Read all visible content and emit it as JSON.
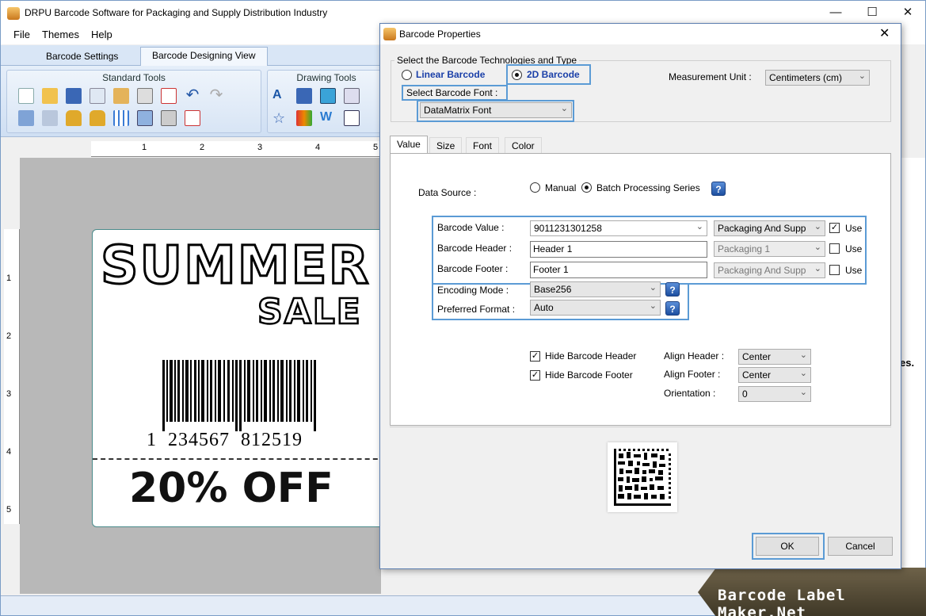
{
  "app": {
    "title": "DRPU Barcode Software for Packaging and Supply Distribution Industry",
    "menu": [
      "File",
      "Themes",
      "Help"
    ],
    "ribbon_tabs": [
      "Barcode Settings",
      "Barcode Designing View"
    ],
    "groups": {
      "standard": "Standard Tools",
      "drawing": "Drawing Tools"
    },
    "ruler_h": [
      "1",
      "2",
      "3",
      "4",
      "5"
    ],
    "ruler_v": [
      "1",
      "2",
      "3",
      "4",
      "5"
    ],
    "label": {
      "headline": "SUMMER",
      "subline": "SALE",
      "barcode_digits": "1  234567  812519",
      "offer": "20% OFF"
    },
    "stub_text": "es.",
    "watermark": "Barcode Label Maker.Net"
  },
  "dialog": {
    "title": "Barcode Properties",
    "tech_group_title": "Select the Barcode Technologies and Type",
    "linear_label": "Linear Barcode",
    "twod_label": "2D Barcode",
    "selected_type": "2D Barcode",
    "font_label": "Select Barcode Font :",
    "font_value": "DataMatrix Font",
    "measurement_label": "Measurement Unit :",
    "measurement_value": "Centimeters (cm)",
    "tabs": [
      "Value",
      "Size",
      "Font",
      "Color"
    ],
    "active_tab": "Value",
    "data_source_label": "Data Source :",
    "manual_label": "Manual",
    "batch_label": "Batch Processing Series",
    "data_source_selected": "Batch Processing Series",
    "barcode_value_label": "Barcode Value :",
    "barcode_value": "9011231301258",
    "barcode_value_series": "Packaging And Supp",
    "barcode_value_use": true,
    "header_label": "Barcode Header :",
    "header_value": "Header 1",
    "header_series": "Packaging 1",
    "header_use": false,
    "footer_label": "Barcode Footer :",
    "footer_value": "Footer 1",
    "footer_series": "Packaging And Supp",
    "footer_use": false,
    "use_label": "Use",
    "encoding_label": "Encoding Mode :",
    "encoding_value": "Base256",
    "format_label": "Preferred Format :",
    "format_value": "Auto",
    "hide_header_label": "Hide Barcode Header",
    "hide_header": true,
    "hide_footer_label": "Hide Barcode Footer",
    "hide_footer": true,
    "align_header_label": "Align Header :",
    "align_header_value": "Center",
    "align_footer_label": "Align Footer :",
    "align_footer_value": "Center",
    "orientation_label": "Orientation :",
    "orientation_value": "0",
    "ok_label": "OK",
    "cancel_label": "Cancel"
  }
}
